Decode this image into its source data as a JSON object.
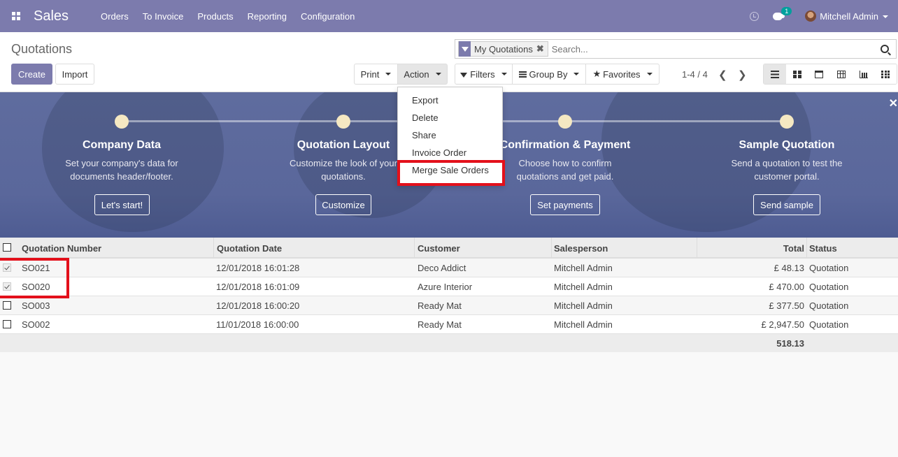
{
  "navbar": {
    "brand": "Sales",
    "menu": [
      "Orders",
      "To Invoice",
      "Products",
      "Reporting",
      "Configuration"
    ],
    "chat_badge": "1",
    "user": "Mitchell Admin"
  },
  "control_panel": {
    "title": "Quotations",
    "create_label": "Create",
    "import_label": "Import",
    "print_label": "Print",
    "action_label": "Action",
    "search_facet": "My Quotations",
    "search_placeholder": "Search...",
    "filters_label": "Filters",
    "groupby_label": "Group By",
    "favorites_label": "Favorites",
    "pager": "1-4 / 4"
  },
  "action_menu": {
    "items": [
      "Export",
      "Delete",
      "Share",
      "Invoice Order",
      "Merge Sale Orders"
    ]
  },
  "banner": {
    "steps": [
      {
        "title": "Company Data",
        "desc": "Set your company's data for documents header/footer.",
        "button": "Let's start!"
      },
      {
        "title": "Quotation Layout",
        "desc": "Customize the look of your quotations.",
        "button": "Customize"
      },
      {
        "title": "Confirmation & Payment",
        "desc": "Choose how to confirm quotations and get paid.",
        "button": "Set payments"
      },
      {
        "title": "Sample Quotation",
        "desc": "Send a quotation to test the customer portal.",
        "button": "Send sample"
      }
    ]
  },
  "table": {
    "columns": [
      "Quotation Number",
      "Quotation Date",
      "Customer",
      "Salesperson",
      "Total",
      "Status"
    ],
    "rows": [
      {
        "number": "SO021",
        "date": "12/01/2018 16:01:28",
        "customer": "Deco Addict",
        "salesperson": "Mitchell Admin",
        "total": "£ 48.13",
        "status": "Quotation",
        "checked": true
      },
      {
        "number": "SO020",
        "date": "12/01/2018 16:01:09",
        "customer": "Azure Interior",
        "salesperson": "Mitchell Admin",
        "total": "£ 470.00",
        "status": "Quotation",
        "checked": true
      },
      {
        "number": "SO003",
        "date": "12/01/2018 16:00:20",
        "customer": "Ready Mat",
        "salesperson": "Mitchell Admin",
        "total": "£ 377.50",
        "status": "Quotation",
        "checked": false
      },
      {
        "number": "SO002",
        "date": "11/01/2018 16:00:00",
        "customer": "Ready Mat",
        "salesperson": "Mitchell Admin",
        "total": "£ 2,947.50",
        "status": "Quotation",
        "checked": false
      }
    ],
    "footer_total": "518.13"
  },
  "colors": {
    "brand": "#7c7bad",
    "highlight": "#e3101b",
    "banner": "#5a679b"
  }
}
